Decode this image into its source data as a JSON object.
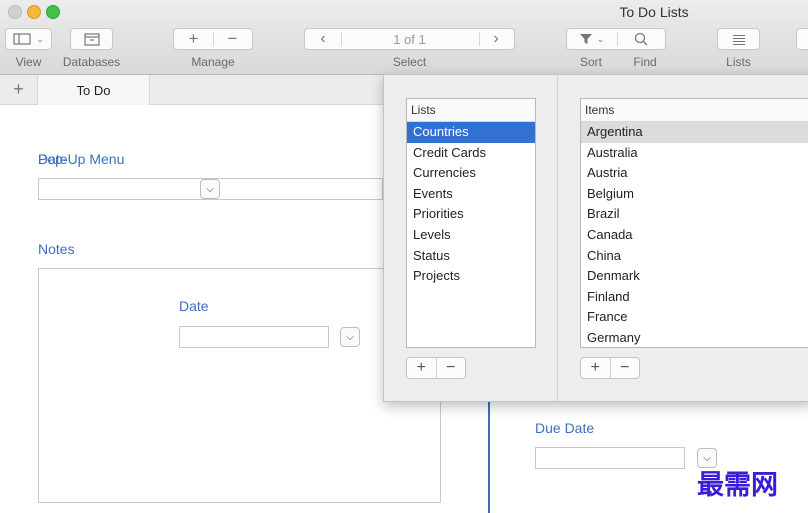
{
  "window": {
    "title": "To Do Lists"
  },
  "toolbar": {
    "view_label": "View",
    "databases_label": "Databases",
    "manage_label": "Manage",
    "select_label": "Select",
    "record_indicator": "1 of 1",
    "sort_label": "Sort",
    "find_label": "Find",
    "lists_label": "Lists"
  },
  "tabs": {
    "active": "To Do"
  },
  "layout": {
    "overlap_label_a": "Date",
    "overlap_label_b": "Pop-Up Menu",
    "notes_label": "Notes",
    "inner_date_label": "Date",
    "due_date_label": "Due Date"
  },
  "popover": {
    "lists_header": "Lists",
    "items_header": "Items",
    "lists": [
      "Countries",
      "Credit Cards",
      "Currencies",
      "Events",
      "Priorities",
      "Levels",
      "Status",
      "Projects"
    ],
    "items": [
      "Argentina",
      "Australia",
      "Austria",
      "Belgium",
      "Brazil",
      "Canada",
      "China",
      "Denmark",
      "Finland",
      "France",
      "Germany"
    ],
    "add_symbol": "+",
    "remove_symbol": "−"
  },
  "watermark": "最需网",
  "colors": {
    "accent": "#3d6fbd",
    "selection": "#3370d4",
    "watermark": "#3c1cd6"
  }
}
